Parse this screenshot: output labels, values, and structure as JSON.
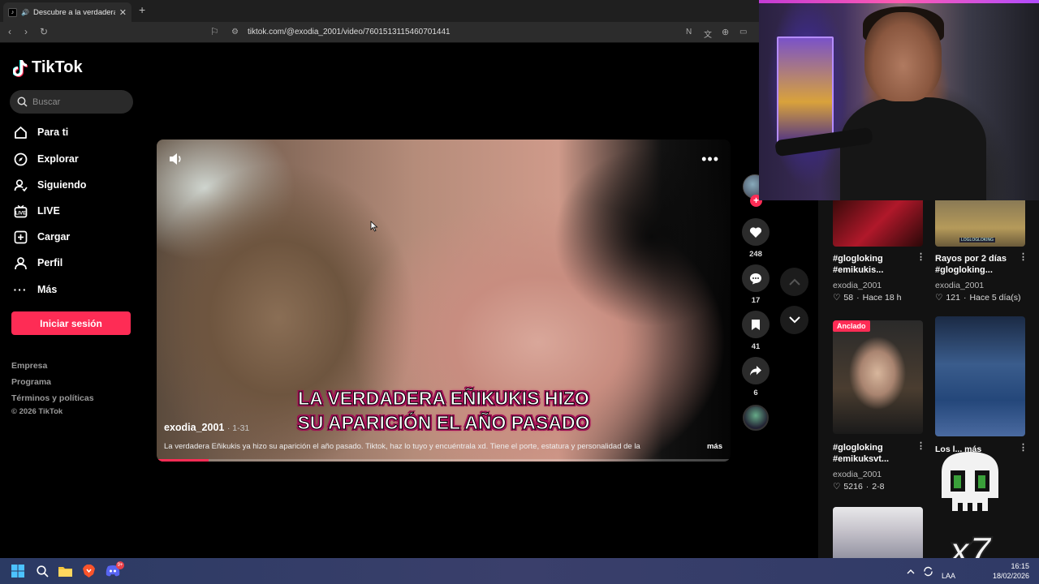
{
  "browser": {
    "tab_title": "Descubre a la verdadera Eñikukis",
    "url": "tiktok.com/@exodia_2001/video/7601513115460701441",
    "newtab_label": "+"
  },
  "sidebar": {
    "brand": "TikTok",
    "search_placeholder": "Buscar",
    "items": [
      {
        "label": "Para ti",
        "icon": "home-icon"
      },
      {
        "label": "Explorar",
        "icon": "compass-icon"
      },
      {
        "label": "Siguiendo",
        "icon": "following-icon"
      },
      {
        "label": "LIVE",
        "icon": "live-icon"
      },
      {
        "label": "Cargar",
        "icon": "upload-icon"
      },
      {
        "label": "Perfil",
        "icon": "profile-icon"
      },
      {
        "label": "Más",
        "icon": "more-icon"
      }
    ],
    "login_label": "Iniciar sesión",
    "footer": [
      "Empresa",
      "Programa",
      "Términos y políticas",
      "© 2026 TikTok"
    ]
  },
  "video": {
    "caption_line1": "LA   VERDADERA EÑIKUKIS HIZO",
    "caption_line2": "SU APARICIÓN EL AÑO PASADO",
    "author": "exodia_2001",
    "date": "· 1-31",
    "description": "La verdadera Eñikukis ya hizo su aparición el año pasado. Tiktok, haz lo tuyo y encuéntrala xd. Tiene el porte, estatura y personalidad de la",
    "more_label": "más",
    "progress": 0.09
  },
  "actions": {
    "likes": "248",
    "comments": "17",
    "saves": "41",
    "shares": "6"
  },
  "related": [
    {
      "title": "#glogloking #emikukis...",
      "author": "exodia_2001",
      "likes": "58",
      "time": "Hace 18 h"
    },
    {
      "title": "Rayos por 2 días #glogloking...",
      "author": "exodia_2001",
      "likes": "121",
      "time": "Hace 5 día(s)",
      "thumb_text": "LOGLOGLOKING"
    },
    {
      "title": "#glogloking #emikuksvt...",
      "author": "exodia_2001",
      "likes": "5216",
      "time": "2-8",
      "pinned": "Anclado"
    },
    {
      "title": "Los l... más",
      "author": "",
      "likes": "",
      "time": ""
    }
  ],
  "overlay": {
    "multiplier": "x7"
  },
  "taskbar": {
    "time": "16:15",
    "date": "18/02/2026",
    "lang": "LAA",
    "discord_badge": "9+"
  },
  "colors": {
    "accent": "#fe2c55",
    "bg": "#000000",
    "panel": "#121212"
  }
}
